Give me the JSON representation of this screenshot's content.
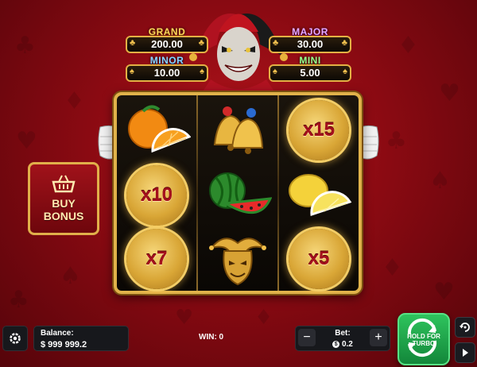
{
  "jackpots": {
    "grand": {
      "label": "GRAND",
      "value": "200.00"
    },
    "minor": {
      "label": "MINOR",
      "value": "10.00"
    },
    "major": {
      "label": "MAJOR",
      "value": "30.00"
    },
    "mini": {
      "label": "MINI",
      "value": "5.00"
    }
  },
  "reels": {
    "multipliers": {
      "r1c3": "x15",
      "r2c1": "x10",
      "r3c1": "x7",
      "r3c3": "x5"
    },
    "symbols": [
      "orange",
      "bells",
      "x15",
      "x10",
      "watermelon",
      "lemon",
      "x7",
      "jester-mask",
      "x5"
    ]
  },
  "buy_bonus": {
    "line1": "BUY",
    "line2": "BONUS",
    "icon": "basket-icon"
  },
  "bottom_bar": {
    "balance_label": "Balance:",
    "balance_value": "$ 999 999.2",
    "win_text": "WIN: 0",
    "bet_label": "Bet:",
    "bet_value": "0.2",
    "spin_label_line1": "HOLD FOR",
    "spin_label_line2": "TURBO"
  },
  "colors": {
    "background": "#8a0a12",
    "gold": "#e0b24a",
    "spin_green": "#1fa84a",
    "multiplier_red": "#a4101c"
  }
}
